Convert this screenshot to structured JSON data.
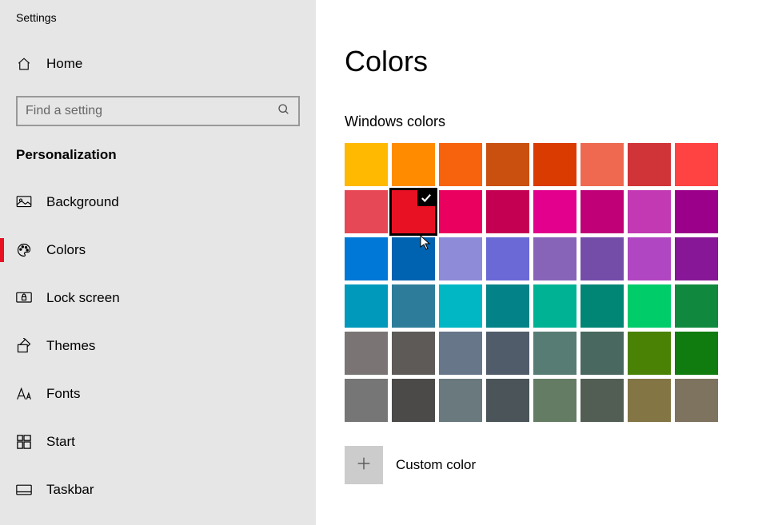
{
  "app_title": "Settings",
  "home_label": "Home",
  "search": {
    "placeholder": "Find a setting"
  },
  "section_title": "Personalization",
  "nav": [
    {
      "key": "background",
      "label": "Background",
      "active": false
    },
    {
      "key": "colors",
      "label": "Colors",
      "active": true
    },
    {
      "key": "lock-screen",
      "label": "Lock screen",
      "active": false
    },
    {
      "key": "themes",
      "label": "Themes",
      "active": false
    },
    {
      "key": "fonts",
      "label": "Fonts",
      "active": false
    },
    {
      "key": "start",
      "label": "Start",
      "active": false
    },
    {
      "key": "taskbar",
      "label": "Taskbar",
      "active": false
    }
  ],
  "page": {
    "title": "Colors",
    "windows_colors_heading": "Windows colors",
    "selected_index": 9,
    "swatches": [
      "#ffb900",
      "#ff8c00",
      "#f7630c",
      "#ca5010",
      "#da3b01",
      "#ef6950",
      "#d13438",
      "#ff4343",
      "#e74856",
      "#e81123",
      "#ea005e",
      "#c30052",
      "#e3008c",
      "#bf0077",
      "#c239b3",
      "#9a0089",
      "#0078d7",
      "#0063b1",
      "#8e8cd8",
      "#6b69d6",
      "#8764b8",
      "#744da9",
      "#b146c2",
      "#881798",
      "#0099bc",
      "#2d7d9a",
      "#00b7c3",
      "#038387",
      "#00b294",
      "#018574",
      "#00cc6a",
      "#10893e",
      "#7a7574",
      "#5d5a58",
      "#68768a",
      "#515c6b",
      "#567c73",
      "#486860",
      "#498205",
      "#107c10",
      "#767676",
      "#4c4a48",
      "#69797e",
      "#4a5459",
      "#647c64",
      "#525e54",
      "#847545",
      "#7e735f"
    ],
    "custom_color_label": "Custom color"
  }
}
